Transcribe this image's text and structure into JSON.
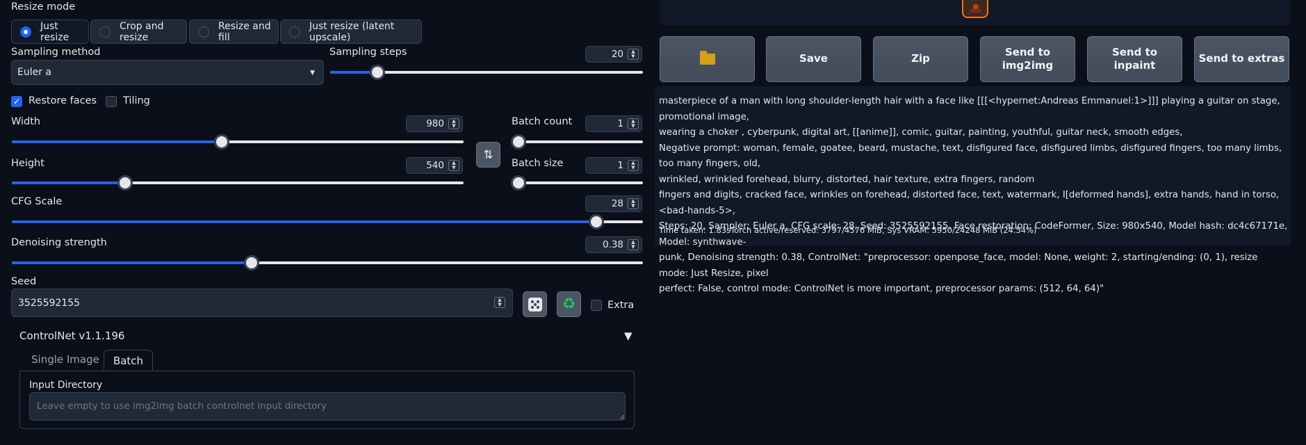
{
  "resize_mode": {
    "label": "Resize mode",
    "options": [
      "Just resize",
      "Crop and resize",
      "Resize and fill",
      "Just resize (latent upscale)"
    ],
    "selected": "Just resize"
  },
  "sampling_method": {
    "label": "Sampling method",
    "value": "Euler a"
  },
  "sampling_steps": {
    "label": "Sampling steps",
    "value": "20",
    "fraction": 0.15
  },
  "restore_faces": {
    "label": "Restore faces",
    "checked": true
  },
  "tiling": {
    "label": "Tiling",
    "checked": false
  },
  "width": {
    "label": "Width",
    "value": "980",
    "fraction": 0.465
  },
  "height": {
    "label": "Height",
    "value": "540",
    "fraction": 0.25
  },
  "batch_count": {
    "label": "Batch count",
    "value": "1",
    "fraction": 0.0
  },
  "batch_size": {
    "label": "Batch size",
    "value": "1",
    "fraction": 0.0
  },
  "swap_icon": "swap-vertical-icon",
  "cfg_scale": {
    "label": "CFG Scale",
    "value": "28",
    "fraction": 0.926
  },
  "denoising_strength": {
    "label": "Denoising strength",
    "value": "0.38",
    "fraction": 0.38
  },
  "seed": {
    "label": "Seed",
    "value": "3525592155",
    "extra_label": "Extra"
  },
  "controlnet": {
    "title": "ControlNet v1.1.196",
    "tabs": [
      "Single Image",
      "Batch"
    ],
    "active_tab": "Batch",
    "input_directory_label": "Input Directory",
    "input_directory_placeholder": "Leave empty to use img2img batch controlnet input directory"
  },
  "output_buttons": {
    "folder_icon": "folder-icon",
    "save": "Save",
    "zip": "Zip",
    "send_img2img_line1": "Send to",
    "send_img2img_line2": "img2img",
    "send_inpaint_line1": "Send to",
    "send_inpaint_line2": "inpaint",
    "send_extras": "Send to extras"
  },
  "generation_info": {
    "line1": "masterpiece of a man with long shoulder-length hair with a face like [[[<hypernet:Andreas Emmanuel:1>]]] playing a guitar on stage, promotional image,",
    "line2": "wearing a choker , cyberpunk, digital art, [[anime]], comic, guitar, painting, youthful, guitar neck, smooth edges,",
    "line3": "Negative prompt: woman, female, goatee, beard, mustache, text, disfigured face, disfigured limbs, disfigured fingers, too many limbs, too many fingers, old,",
    "line4": "wrinkled, wrinkled forehead, blurry, distorted, hair texture, extra fingers, random",
    "line5": "fingers and digits, cracked face, wrinkles on forehead, distorted face, text, watermark, I[deformed hands], extra hands, hand in torso, <bad-hands-5>,",
    "line6": "Steps: 20, Sampler: Euler a, CFG scale: 28, Seed: 3525592155, Face restoration: CodeFormer, Size: 980x540, Model hash: dc4c67171e, Model: synthwave-",
    "line7": "punk, Denoising strength: 0.38, ControlNet: \"preprocessor: openpose_face, model: None, weight: 2, starting/ending: (0, 1), resize mode: Just Resize, pixel",
    "line8": "perfect: False, control mode: ControlNet is more important, preprocessor params: (512, 64, 64)\"",
    "time_taken": "Time taken: 1.83sTorch active/reserved: 3797/4576 MiB, Sys VRAM: 5950/24248 MiB (24.54%)"
  },
  "colors": {
    "accent": "#2563eb",
    "background": "#0b0f19",
    "panel": "#111827"
  }
}
